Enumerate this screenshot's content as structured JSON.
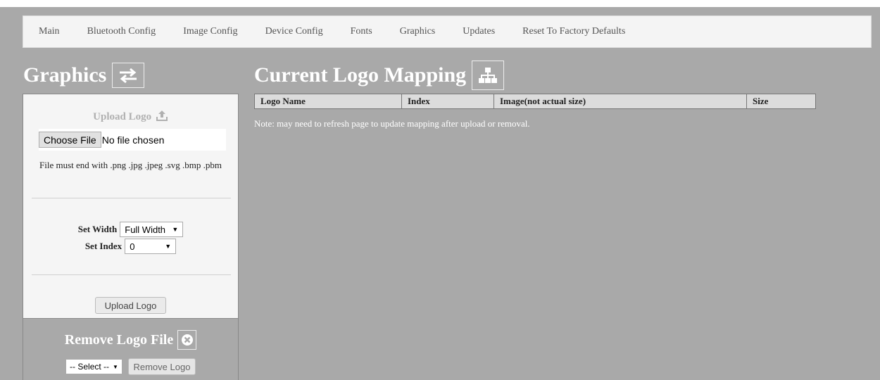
{
  "nav": {
    "items": [
      "Main",
      "Bluetooth Config",
      "Image Config",
      "Device Config",
      "Fonts",
      "Graphics",
      "Updates",
      "Reset To Factory Defaults"
    ]
  },
  "graphics_heading": {
    "title": "Graphics",
    "icon": "swap-arrows-icon"
  },
  "upload": {
    "title": "Upload Logo",
    "icon": "upload-icon",
    "choose_file_label": "Choose File",
    "file_status": "No file chosen",
    "file_note": "File must end with .png .jpg .jpeg .svg .bmp .pbm",
    "set_width_label": "Set Width",
    "set_width_value": "Full Width",
    "set_index_label": "Set Index",
    "set_index_value": "0",
    "upload_button": "Upload Logo"
  },
  "remove": {
    "title": "Remove Logo File",
    "icon": "close-circle-icon",
    "select_value": "-- Select --",
    "remove_button": "Remove Logo"
  },
  "mapping": {
    "title": "Current Logo Mapping",
    "icon": "sitemap-icon",
    "columns": [
      "Logo Name",
      "Index",
      "Image(not actual size)",
      "Size"
    ],
    "note": "Note: may need to refresh page to update mapping after upload or removal."
  },
  "colors": {
    "background": "#a9a9a9",
    "panel": "#f5f5f5",
    "nav": "#f4f4f4",
    "heading_text": "#ffffff"
  }
}
